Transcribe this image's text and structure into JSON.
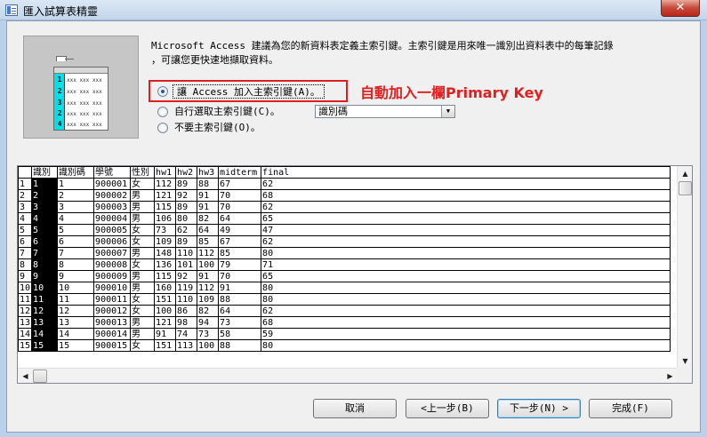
{
  "window": {
    "title": "匯入試算表精靈",
    "close_glyph": "✕"
  },
  "illustration": {
    "icon_name": "table-primary-key-illustration",
    "rows": [
      "1",
      "2",
      "3",
      "2",
      "4"
    ],
    "cell_text": "xxx xxx xxx"
  },
  "description": {
    "line1": "Microsoft Access 建議為您的新資料表定義主索引鍵。主索引鍵是用來唯一識別出資料表中的每筆記錄",
    "line2": "，可讓您更快速地擷取資料。"
  },
  "options": {
    "auto": "讓 Access 加入主索引鍵(A)。",
    "choose": "自行選取主索引鍵(C)。",
    "none": "不要主索引鍵(O)。",
    "selected": "auto"
  },
  "key_field_select": {
    "value": "識別碼"
  },
  "annotation": {
    "text": "自動加入一欄Primary Key",
    "color": "#e02020"
  },
  "grid": {
    "headers": [
      "識別",
      "識別碼",
      "學號",
      "性別",
      "hw1",
      "hw2",
      "hw3",
      "midterm",
      "final"
    ],
    "rows": [
      [
        "1",
        "1",
        "1",
        "900001",
        "女",
        "112",
        "89",
        "88",
        "67",
        "62"
      ],
      [
        "2",
        "2",
        "2",
        "900002",
        "男",
        "121",
        "92",
        "91",
        "70",
        "68"
      ],
      [
        "3",
        "3",
        "3",
        "900003",
        "男",
        "115",
        "89",
        "91",
        "70",
        "62"
      ],
      [
        "4",
        "4",
        "4",
        "900004",
        "男",
        "106",
        "80",
        "82",
        "64",
        "65"
      ],
      [
        "5",
        "5",
        "5",
        "900005",
        "女",
        "73",
        "62",
        "64",
        "49",
        "47"
      ],
      [
        "6",
        "6",
        "6",
        "900006",
        "女",
        "109",
        "89",
        "85",
        "67",
        "62"
      ],
      [
        "7",
        "7",
        "7",
        "900007",
        "男",
        "148",
        "110",
        "112",
        "85",
        "80"
      ],
      [
        "8",
        "8",
        "8",
        "900008",
        "女",
        "136",
        "101",
        "100",
        "79",
        "71"
      ],
      [
        "9",
        "9",
        "9",
        "900009",
        "男",
        "115",
        "92",
        "91",
        "70",
        "65"
      ],
      [
        "10",
        "10",
        "10",
        "900010",
        "男",
        "160",
        "119",
        "112",
        "91",
        "80"
      ],
      [
        "11",
        "11",
        "11",
        "900011",
        "女",
        "151",
        "110",
        "109",
        "88",
        "80"
      ],
      [
        "12",
        "12",
        "12",
        "900012",
        "女",
        "100",
        "86",
        "82",
        "64",
        "62"
      ],
      [
        "13",
        "13",
        "13",
        "900013",
        "男",
        "121",
        "98",
        "94",
        "73",
        "68"
      ],
      [
        "14",
        "14",
        "14",
        "900014",
        "男",
        "91",
        "74",
        "73",
        "58",
        "59"
      ],
      [
        "15",
        "15",
        "15",
        "900015",
        "女",
        "151",
        "113",
        "100",
        "88",
        "80"
      ]
    ]
  },
  "buttons": {
    "cancel": "取消",
    "back": "<上一步(B)",
    "next": "下一步(N) >",
    "finish": "完成(F)"
  }
}
